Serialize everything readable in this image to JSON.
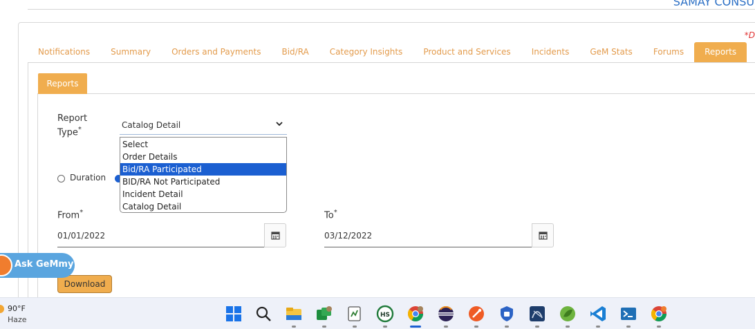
{
  "header": {
    "org_name": "SAMAY CONSUL",
    "mandatory_note": "*D"
  },
  "tabs": [
    {
      "label": "Notifications",
      "active": false
    },
    {
      "label": "Summary",
      "active": false
    },
    {
      "label": "Orders and Payments",
      "active": false
    },
    {
      "label": "Bid/RA",
      "active": false
    },
    {
      "label": "Category Insights",
      "active": false
    },
    {
      "label": "Product and Services",
      "active": false
    },
    {
      "label": "Incidents",
      "active": false
    },
    {
      "label": "GeM Stats",
      "active": false
    },
    {
      "label": "Forums",
      "active": false
    },
    {
      "label": "Reports",
      "active": true
    }
  ],
  "subtab": {
    "label": "Reports"
  },
  "form": {
    "report_type_label_1": "Report",
    "report_type_label_2": "Type",
    "report_type_value": "Catalog Detail",
    "dropdown_options": [
      {
        "label": "Select",
        "highlighted": false
      },
      {
        "label": "Order Details",
        "highlighted": false
      },
      {
        "label": "Bid/RA Participated",
        "highlighted": true
      },
      {
        "label": "BID/RA Not Participated",
        "highlighted": false
      },
      {
        "label": "Incident Detail",
        "highlighted": false
      },
      {
        "label": "Catalog Detail",
        "highlighted": false
      }
    ],
    "duration_label": "Duration",
    "from_label": "From",
    "from_value": "01/01/2022",
    "to_label": "To",
    "to_value": "03/12/2022",
    "download_label": "Download",
    "required_mark": "*"
  },
  "assistant": {
    "label": "Ask GeMmy"
  },
  "taskbar": {
    "weather_temp": "90°F",
    "weather_condition": "Haze",
    "icons": [
      "windows-start-icon",
      "search-icon",
      "file-explorer-icon",
      "chat-app-icon",
      "notepad-icon",
      "hubspot-icon",
      "chrome-icon",
      "eclipse-icon",
      "postman-icon",
      "security-app-icon",
      "sql-server-icon",
      "spring-tools-icon",
      "vscode-icon",
      "powershell-icon",
      "chrome-profile-icon"
    ]
  }
}
